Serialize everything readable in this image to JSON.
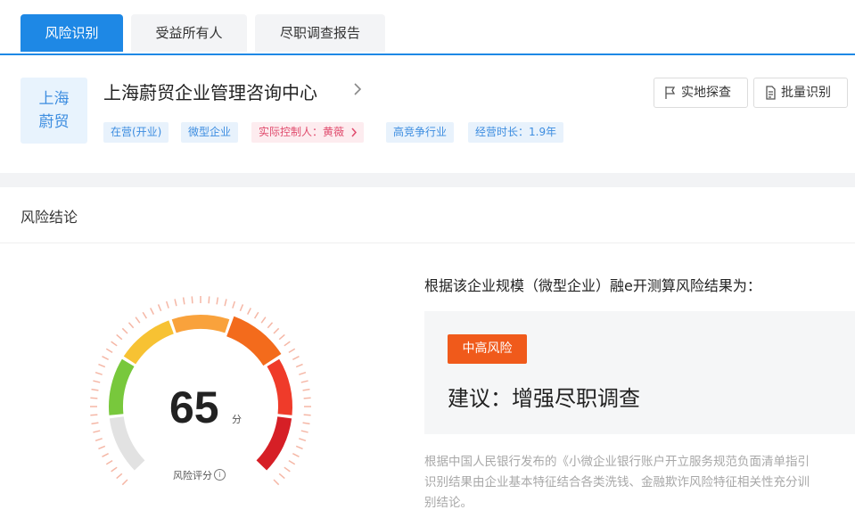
{
  "tabs": [
    {
      "label": "风险识别",
      "active": true
    },
    {
      "label": "受益所有人",
      "active": false
    },
    {
      "label": "尽职调查报告",
      "active": false
    }
  ],
  "company": {
    "logo_line1": "上海",
    "logo_line2": "蔚贸",
    "name": "上海蔚贸企业管理咨询中心",
    "tags": {
      "status": "在营(开业)",
      "scale": "微型企业",
      "controller": "实际控制人：黄薇",
      "industry": "高竞争行业",
      "duration": "经营时长：1.9年"
    },
    "actions": {
      "field_survey": "实地探查",
      "batch_identify": "批量识别"
    }
  },
  "section": {
    "title": "风险结论"
  },
  "gauge": {
    "score": "65",
    "score_value": 65,
    "max_score": 100,
    "unit": "分",
    "label": "风险评分",
    "info_icon": "info-icon"
  },
  "result": {
    "intro": "根据该企业规模（微型企业）融e开测算风险结果为：",
    "risk_level": "中高风险",
    "suggestion": "建议：增强尽职调查"
  },
  "footnote": {
    "line1": "根据中国人民银行发布的《小微企业银行账户开立服务规范负面清单指引",
    "line2": "识别结果由企业基本特征结合各类洗钱、金融欺诈风险特征相关性充分训",
    "line3": "别结论。"
  },
  "colors": {
    "primary": "#1e88e5",
    "risk_badge": "#f05a1b",
    "tag_blue_bg": "#e8f2fc",
    "tag_pink_bg": "#fdecef",
    "gauge_segments": [
      "#e2e2e2",
      "#78c83c",
      "#f7c233",
      "#f9a23c",
      "#f36b1c",
      "#ef3b2a",
      "#d61f26"
    ]
  }
}
